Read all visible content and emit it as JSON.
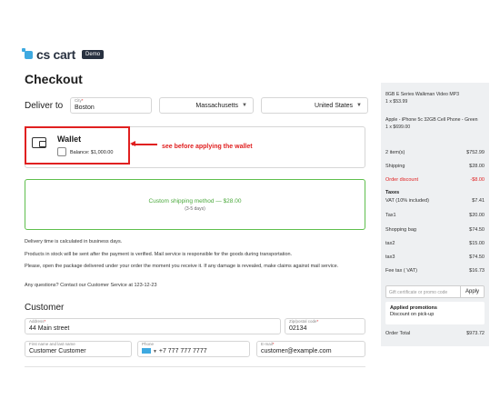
{
  "brand": {
    "name": "cs cart",
    "badge": "Demo"
  },
  "page_title": "Checkout",
  "delivery": {
    "label": "Deliver to",
    "city_label": "City",
    "city_value": "Boston",
    "state": "Massachusetts",
    "country": "United States"
  },
  "wallet": {
    "title": "Wallet",
    "balance": "Balance: $1,000.00",
    "annotation": "see before applying the wallet"
  },
  "shipping": {
    "method": "Custom shipping method — $28.00",
    "days": "(3-5 days)"
  },
  "info_lines": [
    "Delivery time is calculated in business days.",
    "Products in stock will be sent after the payment is verified. Mail service is responsible for the goods during transportation.",
    "Please, open the package delivered under your order the moment you receive it. If any damage is revealed, make claims against mail service.",
    "Any questions? Contact our Customer Service at 123-12-23"
  ],
  "customer": {
    "section_title": "Customer",
    "address_label": "Address",
    "address_value": "44 Main street",
    "zip_label": "Zip/postal code",
    "zip_value": "02134",
    "name_label": "First name and last name",
    "name_value": "Customer Customer",
    "phone_label": "Phone",
    "phone_value": "+7 777 777 7777",
    "email_label": "E-mail",
    "email_value": "customer@example.com"
  },
  "summary": {
    "products": [
      {
        "name": "8GB E Series Walkman Video MP3",
        "qty": "1 x $53.99"
      },
      {
        "name": "Apple - iPhone 5c 32GB Cell Phone - Green",
        "qty": "1 x $699.00"
      }
    ],
    "lines": [
      {
        "label": "2 item(s)",
        "value": "$752.99"
      },
      {
        "label": "Shipping",
        "value": "$28.00"
      },
      {
        "label": "Order discount",
        "value": "-$8.00"
      }
    ],
    "taxes_title": "Taxes",
    "taxes": [
      {
        "label": "VAT (10% included)",
        "value": "$7.41"
      },
      {
        "label": "Tax1",
        "value": "$20.00"
      },
      {
        "label": "Shopping bag",
        "value": "$74.50"
      },
      {
        "label": "tax2",
        "value": "$15.00"
      },
      {
        "label": "tax3",
        "value": "$74.50"
      },
      {
        "label": "Fee tax ( VAT)",
        "value": "$16.73"
      }
    ],
    "promo_placeholder": "Gift certificate or promo code",
    "apply_label": "Apply",
    "applied_title": "Applied promotions",
    "applied_item": "Discount on pick-up",
    "total_label": "Order Total",
    "total_value": "$973.72"
  },
  "colors": {
    "accent_red": "#e02020",
    "shipping_green": "#5fbf4c",
    "sidebar_bg": "#eef0f2"
  }
}
